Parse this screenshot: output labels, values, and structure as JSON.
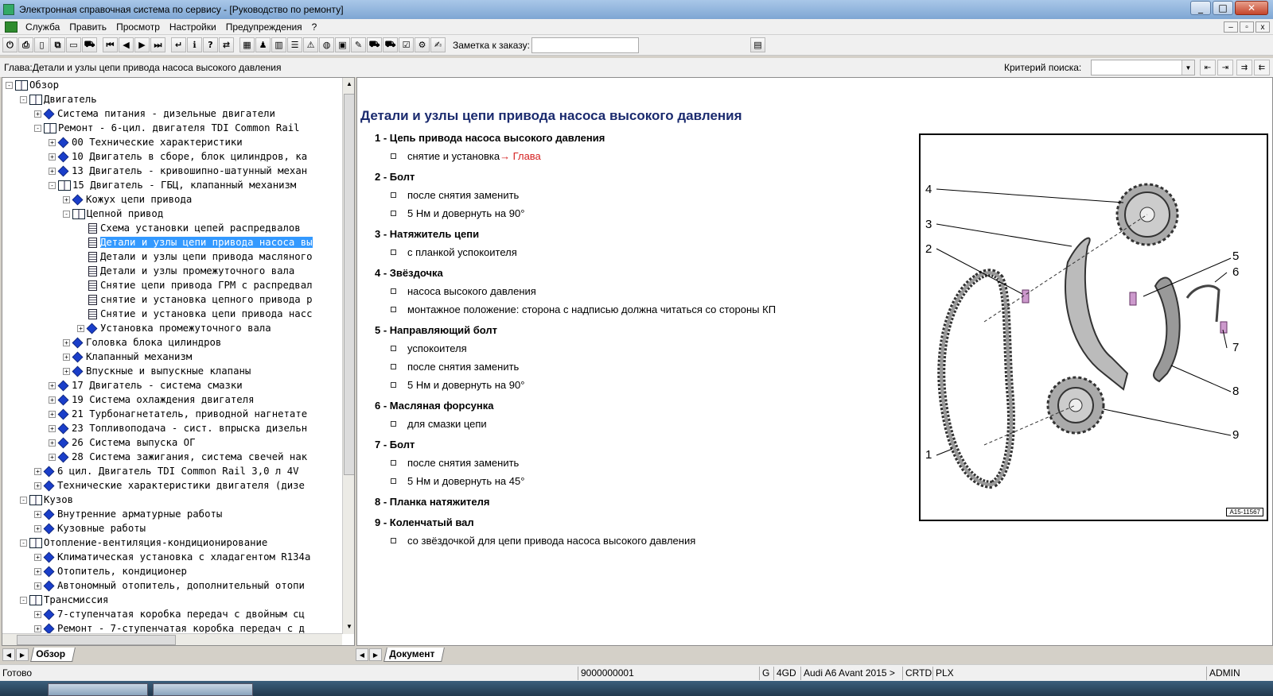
{
  "window": {
    "title": "Электронная справочная система по сервису - [Руководство по ремонту]"
  },
  "menu": [
    "Служба",
    "Править",
    "Просмотр",
    "Настройки",
    "Предупреждения",
    "?"
  ],
  "toolbar": {
    "buttons": [
      "exit-icon",
      "print-icon",
      "new-icon",
      "copy-icon",
      "open-icon",
      "car-icon",
      "first-icon",
      "prev-icon",
      "next-icon",
      "last-icon",
      "back-icon",
      "info-icon",
      "help-icon",
      "swap-icon",
      "grid-icon",
      "person-icon",
      "book-icon",
      "list-icon",
      "warning-icon",
      "globe-icon",
      "package-icon",
      "tool-icon",
      "car2-icon",
      "bus-icon",
      "checklist-icon",
      "settings-icon",
      "notepad-icon"
    ],
    "note_label": "Заметка к заказу:"
  },
  "chapter_bar": {
    "label": "Глава:Детали и узлы цепи привода насоса высокого давления",
    "criteria_label": "Критерий  поиска:"
  },
  "tree": [
    {
      "level": 0,
      "exp": "-",
      "icon": "open",
      "label": "Обзор"
    },
    {
      "level": 1,
      "exp": "-",
      "icon": "open",
      "label": "Двигатель"
    },
    {
      "level": 2,
      "exp": "+",
      "icon": "closed",
      "label": "Система питания - дизельные двигатели"
    },
    {
      "level": 2,
      "exp": "-",
      "icon": "open",
      "label": "Ремонт - 6-цил. двигателя TDI Common Rail"
    },
    {
      "level": 3,
      "exp": "+",
      "icon": "closed",
      "label": "00 Технические характеристики"
    },
    {
      "level": 3,
      "exp": "+",
      "icon": "closed",
      "label": "10 Двигатель в сборе, блок цилиндров, ка"
    },
    {
      "level": 3,
      "exp": "+",
      "icon": "closed",
      "label": "13 Двигатель - кривошипно-шатунный механ"
    },
    {
      "level": 3,
      "exp": "-",
      "icon": "open",
      "label": "15 Двигатель - ГБЦ, клапанный механизм"
    },
    {
      "level": 4,
      "exp": "+",
      "icon": "closed",
      "label": "Кожух цепи привода"
    },
    {
      "level": 4,
      "exp": "-",
      "icon": "open",
      "label": "Цепной привод"
    },
    {
      "level": 5,
      "exp": "",
      "icon": "doc",
      "label": "Схема установки цепей распредвалов"
    },
    {
      "level": 5,
      "exp": "",
      "icon": "doc",
      "label": "Детали и узлы цепи привода насоса вы",
      "selected": true
    },
    {
      "level": 5,
      "exp": "",
      "icon": "doc",
      "label": "Детали и узлы цепи привода масляного"
    },
    {
      "level": 5,
      "exp": "",
      "icon": "doc",
      "label": "Детали и узлы промежуточного вала"
    },
    {
      "level": 5,
      "exp": "",
      "icon": "doc",
      "label": "Снятие цепи привода ГРМ с распредвал"
    },
    {
      "level": 5,
      "exp": "",
      "icon": "doc",
      "label": "снятие и установка цепного привода р"
    },
    {
      "level": 5,
      "exp": "",
      "icon": "doc",
      "label": "Снятие и установка цепи привода насс"
    },
    {
      "level": 5,
      "exp": "+",
      "icon": "closed",
      "label": "Установка промежуточного вала"
    },
    {
      "level": 4,
      "exp": "+",
      "icon": "closed",
      "label": "Головка блока цилиндров"
    },
    {
      "level": 4,
      "exp": "+",
      "icon": "closed",
      "label": "Клапанный механизм"
    },
    {
      "level": 4,
      "exp": "+",
      "icon": "closed",
      "label": "Впускные и выпускные клапаны"
    },
    {
      "level": 3,
      "exp": "+",
      "icon": "closed",
      "label": "17 Двигатель - система смазки"
    },
    {
      "level": 3,
      "exp": "+",
      "icon": "closed",
      "label": "19 Система охлаждения двигателя"
    },
    {
      "level": 3,
      "exp": "+",
      "icon": "closed",
      "label": "21 Турбонагнетатель, приводной нагнетате"
    },
    {
      "level": 3,
      "exp": "+",
      "icon": "closed",
      "label": "23 Топливоподача - сист. впрыска дизельн"
    },
    {
      "level": 3,
      "exp": "+",
      "icon": "closed",
      "label": "26 Система выпуска ОГ"
    },
    {
      "level": 3,
      "exp": "+",
      "icon": "closed",
      "label": "28 Система зажигания, система свечей нак"
    },
    {
      "level": 2,
      "exp": "+",
      "icon": "closed",
      "label": "6 цил. Двигатель TDI Common Rail 3,0 л 4V"
    },
    {
      "level": 2,
      "exp": "+",
      "icon": "closed",
      "label": "Технические характеристики двигателя (дизе"
    },
    {
      "level": 1,
      "exp": "-",
      "icon": "open",
      "label": "Кузов"
    },
    {
      "level": 2,
      "exp": "+",
      "icon": "closed",
      "label": "Внутренние арматурные работы"
    },
    {
      "level": 2,
      "exp": "+",
      "icon": "closed",
      "label": "Кузовные работы"
    },
    {
      "level": 1,
      "exp": "-",
      "icon": "open",
      "label": "Отопление-вентиляция-кондиционирование"
    },
    {
      "level": 2,
      "exp": "+",
      "icon": "closed",
      "label": "Климатическая установка с хладагентом R134a"
    },
    {
      "level": 2,
      "exp": "+",
      "icon": "closed",
      "label": "Отопитель, кондиционер"
    },
    {
      "level": 2,
      "exp": "+",
      "icon": "closed",
      "label": "Автономный отопитель, дополнительный отопи"
    },
    {
      "level": 1,
      "exp": "-",
      "icon": "open",
      "label": "Трансмиссия"
    },
    {
      "level": 2,
      "exp": "+",
      "icon": "closed",
      "label": "7-ступенчатая коробка передач с двойным сц"
    },
    {
      "level": 2,
      "exp": "+",
      "icon": "closed",
      "label": "Ремонт - 7-ступенчатая коробка передач с д"
    }
  ],
  "tabs": {
    "left": "Обзор",
    "right": "Документ"
  },
  "document": {
    "title": "Детали и узлы цепи привода насоса высокого давления",
    "items": [
      {
        "head": "1 - Цепь привода насоса высокого давления",
        "subs": [
          {
            "text": "снятие и установка ",
            "link": "→ Глава"
          }
        ]
      },
      {
        "head": "2 - Болт",
        "subs": [
          {
            "text": "после снятия заменить"
          },
          {
            "text": "5 Нм и довернуть на 90°"
          }
        ]
      },
      {
        "head": "3 - Натяжитель цепи",
        "subs": [
          {
            "text": "с планкой успокоителя"
          }
        ]
      },
      {
        "head": "4 - Звёздочка",
        "subs": [
          {
            "text": "насоса высокого давления"
          },
          {
            "text": "монтажное положение: сторона с надписью должна читаться со стороны КП"
          }
        ]
      },
      {
        "head": "5 - Направляющий болт",
        "subs": [
          {
            "text": "успокоителя"
          },
          {
            "text": "после снятия заменить"
          },
          {
            "text": "5 Нм и довернуть на 90°"
          }
        ]
      },
      {
        "head": "6 - Масляная форсунка",
        "subs": [
          {
            "text": "для смазки цепи"
          }
        ]
      },
      {
        "head": "7 - Болт",
        "subs": [
          {
            "text": "после снятия заменить"
          },
          {
            "text": "5 Нм и довернуть на 45°"
          }
        ]
      },
      {
        "head": "8 - Планка натяжителя",
        "subs": []
      },
      {
        "head": "9 - Коленчатый вал",
        "subs": [
          {
            "text": "со звёздочкой для цепи привода насоса высокого давления"
          }
        ]
      }
    ],
    "figure": {
      "labels": [
        "1",
        "2",
        "3",
        "4",
        "5",
        "6",
        "7",
        "8",
        "9"
      ],
      "id": "A15-11567"
    }
  },
  "status": {
    "ready": "Готово",
    "order": "9000000001",
    "g": "G",
    "engine": "4GD",
    "model": "Audi A6 Avant 2015 >",
    "engine_code": "CRTD",
    "plx": "PLX",
    "user": "ADMIN"
  },
  "colors": {
    "title_blue": "#1a2a6e",
    "link_red": "#d42020",
    "selection": "#3399ff"
  }
}
